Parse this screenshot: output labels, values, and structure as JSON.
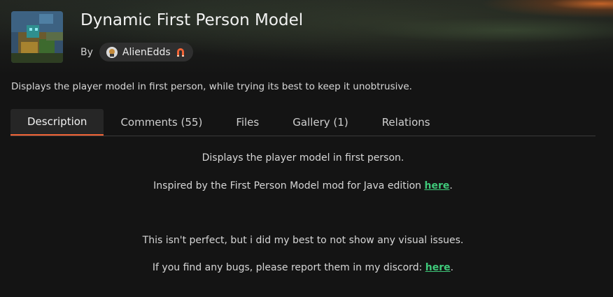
{
  "project": {
    "title": "Dynamic First Person Model",
    "by_label": "By",
    "author": "AlienEdds",
    "author_badge_icon": "magnet-icon",
    "summary": "Displays the player model in first person, while trying its best to keep it unobtrusive."
  },
  "tabs": [
    {
      "label": "Description",
      "active": true
    },
    {
      "label": "Comments (55)",
      "active": false
    },
    {
      "label": "Files",
      "active": false
    },
    {
      "label": "Gallery (1)",
      "active": false
    },
    {
      "label": "Relations",
      "active": false
    }
  ],
  "description": {
    "line1": "Displays the player model in first person.",
    "line2_prefix": "Inspired by the First Person Model mod for Java edition ",
    "line2_link": "here",
    "line2_suffix": ".",
    "line3": "This isn't perfect, but i did my best to not show any visual issues.",
    "line4_prefix": "If you find any bugs, please report them in my discord: ",
    "line4_link": "here",
    "line4_suffix": "."
  },
  "colors": {
    "accent": "#f16436",
    "link": "#3fc97a",
    "background": "#141414",
    "tab_active_bg": "#262626"
  }
}
